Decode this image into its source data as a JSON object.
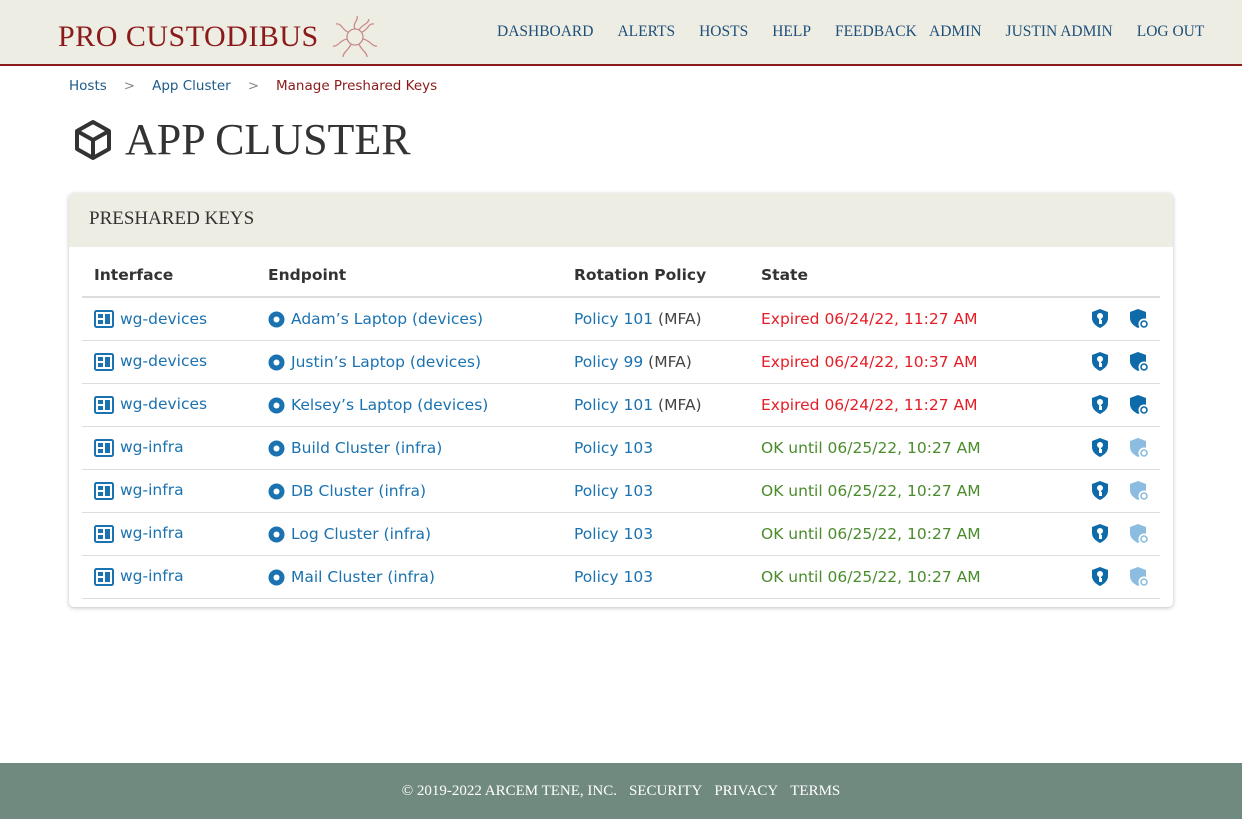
{
  "brand": "PRO CUSTODIBUS",
  "nav": {
    "main": [
      "DASHBOARD",
      "ALERTS",
      "HOSTS",
      "HELP",
      "FEEDBACK"
    ],
    "user": [
      "ADMIN",
      "JUSTIN ADMIN",
      "LOG OUT"
    ]
  },
  "breadcrumb": {
    "items": [
      "Hosts",
      "App Cluster"
    ],
    "sep": ">",
    "current": "Manage Preshared Keys"
  },
  "page_title": "APP CLUSTER",
  "card": {
    "title": "PRESHARED KEYS",
    "columns": [
      "Interface",
      "Endpoint",
      "Rotation Policy",
      "State"
    ],
    "rows": [
      {
        "interface": "wg-devices",
        "endpoint": "Adam’s Laptop (devices)",
        "policy": "Policy 101",
        "policy_note": " (MFA)",
        "state": "Expired 06/24/22, 11:27 AM",
        "status": "expired"
      },
      {
        "interface": "wg-devices",
        "endpoint": "Justin’s Laptop (devices)",
        "policy": "Policy 99",
        "policy_note": " (MFA)",
        "state": "Expired 06/24/22, 10:37 AM",
        "status": "expired"
      },
      {
        "interface": "wg-devices",
        "endpoint": "Kelsey’s Laptop (devices)",
        "policy": "Policy 101",
        "policy_note": " (MFA)",
        "state": "Expired 06/24/22, 11:27 AM",
        "status": "expired"
      },
      {
        "interface": "wg-infra",
        "endpoint": "Build Cluster (infra)",
        "policy": "Policy 103",
        "policy_note": "",
        "state": "OK until 06/25/22, 10:27 AM",
        "status": "ok"
      },
      {
        "interface": "wg-infra",
        "endpoint": "DB Cluster (infra)",
        "policy": "Policy 103",
        "policy_note": "",
        "state": "OK until 06/25/22, 10:27 AM",
        "status": "ok"
      },
      {
        "interface": "wg-infra",
        "endpoint": "Log Cluster (infra)",
        "policy": "Policy 103",
        "policy_note": "",
        "state": "OK until 06/25/22, 10:27 AM",
        "status": "ok"
      },
      {
        "interface": "wg-infra",
        "endpoint": "Mail Cluster (infra)",
        "policy": "Policy 103",
        "policy_note": "",
        "state": "OK until 06/25/22, 10:27 AM",
        "status": "ok"
      }
    ]
  },
  "footer": {
    "copyright": "© 2019-2022 ARCEM TENE, INC.",
    "links": [
      "SECURITY",
      "PRIVACY",
      "TERMS"
    ]
  },
  "colors": {
    "brand": "#8b1a1a",
    "link": "#1a72b0",
    "expired": "#e41e26",
    "ok": "#4a8b2c",
    "footer": "#718a80"
  }
}
